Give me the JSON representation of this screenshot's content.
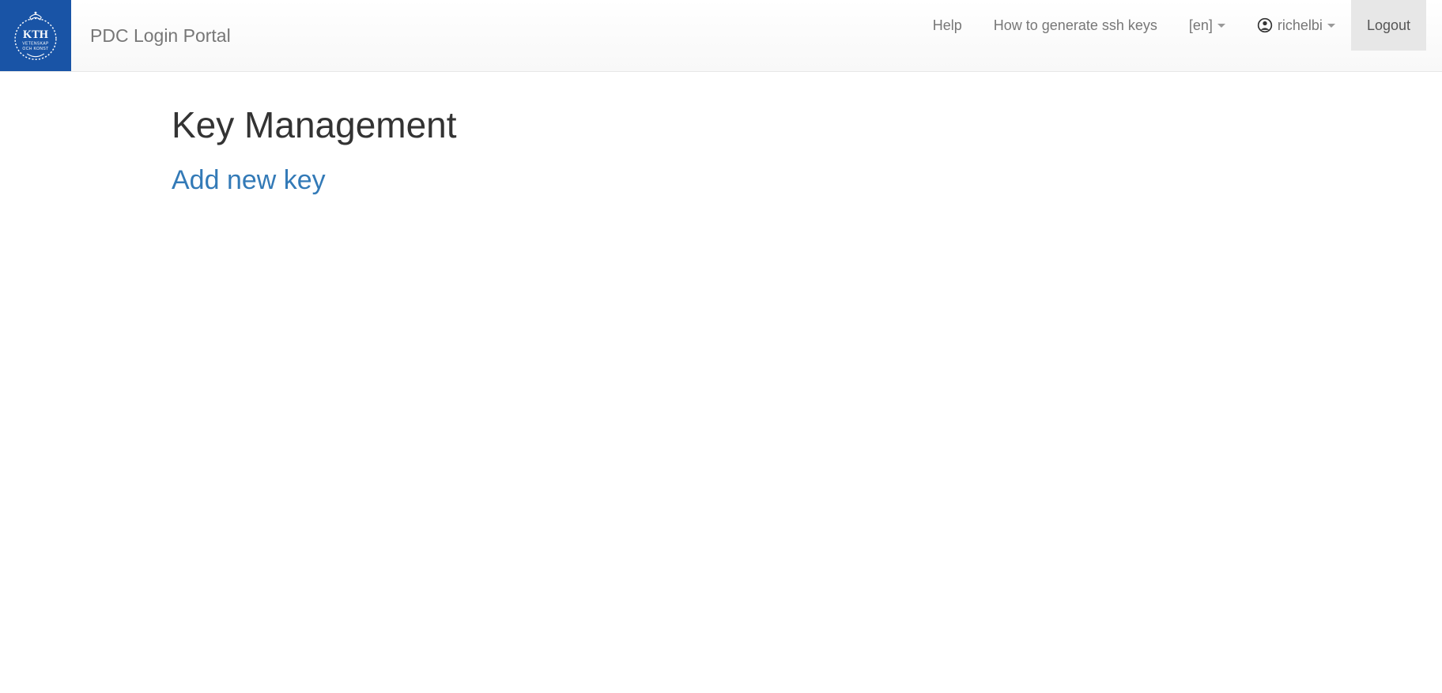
{
  "header": {
    "brand_title": "PDC Login Portal",
    "logo": {
      "label_top": "KTH",
      "label_mid": "VETENSKAP",
      "label_bot": "OCH KONST"
    },
    "nav": {
      "help": "Help",
      "how_to": "How to generate ssh keys",
      "lang": "[en]",
      "username": "richelbi",
      "logout": "Logout"
    }
  },
  "main": {
    "page_title": "Key Management",
    "add_key_label": "Add new key"
  }
}
